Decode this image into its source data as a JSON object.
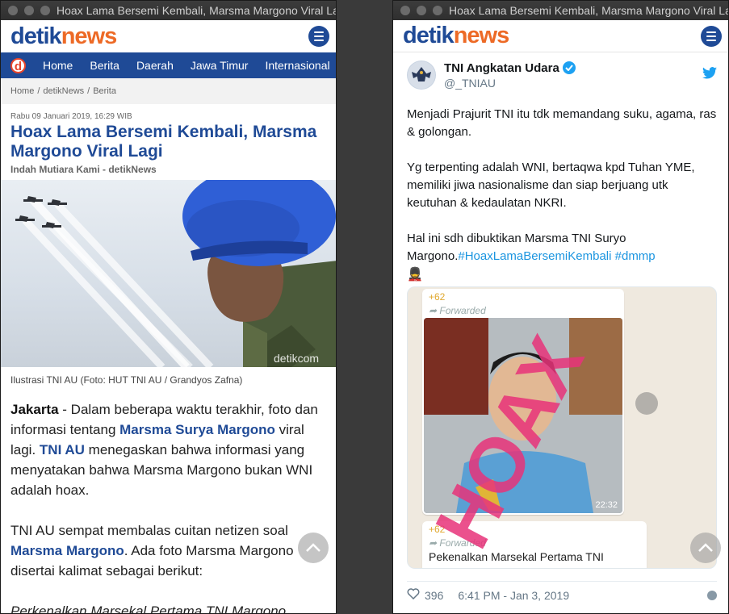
{
  "left_window": {
    "title": "Hoax Lama Bersemi Kembali, Marsma Margono Viral Lagi",
    "logo": {
      "part1": "detik",
      "part2": "news"
    },
    "nav_logo": "d",
    "nav": [
      "Home",
      "Berita",
      "Daerah",
      "Jawa Timur",
      "Internasional"
    ],
    "breadcrumb": [
      "Home",
      "detikNews",
      "Berita"
    ],
    "article": {
      "date": "Rabu 09 Januari 2019, 16:29 WIB",
      "title": "Hoax Lama Bersemi Kembali, Marsma Margono Viral Lagi",
      "author": "Indah Mutiara Kami - detikNews",
      "photo_watermark": "detikcom",
      "caption": "Ilustrasi TNI AU (Foto: HUT TNI AU / Grandyos Zafna)",
      "p1": {
        "location": "Jakarta",
        "t1": " - Dalam beberapa waktu terakhir, foto dan informasi tentang ",
        "link1": "Marsma Surya Margono",
        "t2": " viral lagi. ",
        "link2": "TNI AU",
        "t3": " menegaskan bahwa informasi yang menyatakan bahwa Marsma Margono bukan WNI adalah hoax."
      },
      "p2": {
        "t1": "TNI AU sempat membalas cuitan netizen soal ",
        "link1": "Marsma Margono",
        "t2": ". Ada foto Marsma Margono disertai kalimat sebagai berikut:"
      },
      "p3": "Perkenalkan Marsekal Pertama TNI Margono"
    }
  },
  "right_window": {
    "title": "Hoax Lama Bersemi Kembali, Marsma Margono Viral Lagi",
    "logo": {
      "part1": "detik",
      "part2": "news"
    },
    "tweet": {
      "name": "TNI Angkatan Udara",
      "handle": "@_TNIAU",
      "p1": "Menjadi Prajurit TNI itu tdk memandang suku, agama, ras & golongan.",
      "p2": "Yg terpenting adalah WNI, bertaqwa kpd Tuhan YME, memiliki jiwa nasionalisme dan siap berjuang utk keutuhan & kedaulatan NKRI.",
      "p3_text": "Hal ini sdh dibuktikan Marsma TNI Suryo Margono.",
      "p3_tags": "#HoaxLamaBersemiKembali #dmmp",
      "emoji": "💂",
      "media": {
        "phone1": "+62",
        "forwarded1": "Forwarded",
        "time": "22:32",
        "stamp": "HOAX",
        "phone2": "+62",
        "forwarded2": "Forwarded",
        "msg": "Pekenalkan Marsekal Pertama TNI"
      },
      "likes": "396",
      "timestamp": "6:41 PM - Jan 3, 2019"
    }
  },
  "colors": {
    "brand_blue": "#1f4a96",
    "brand_orange": "#ed6a26",
    "twitter_blue": "#1da1f2",
    "hoax_pink": "#e8337a"
  }
}
